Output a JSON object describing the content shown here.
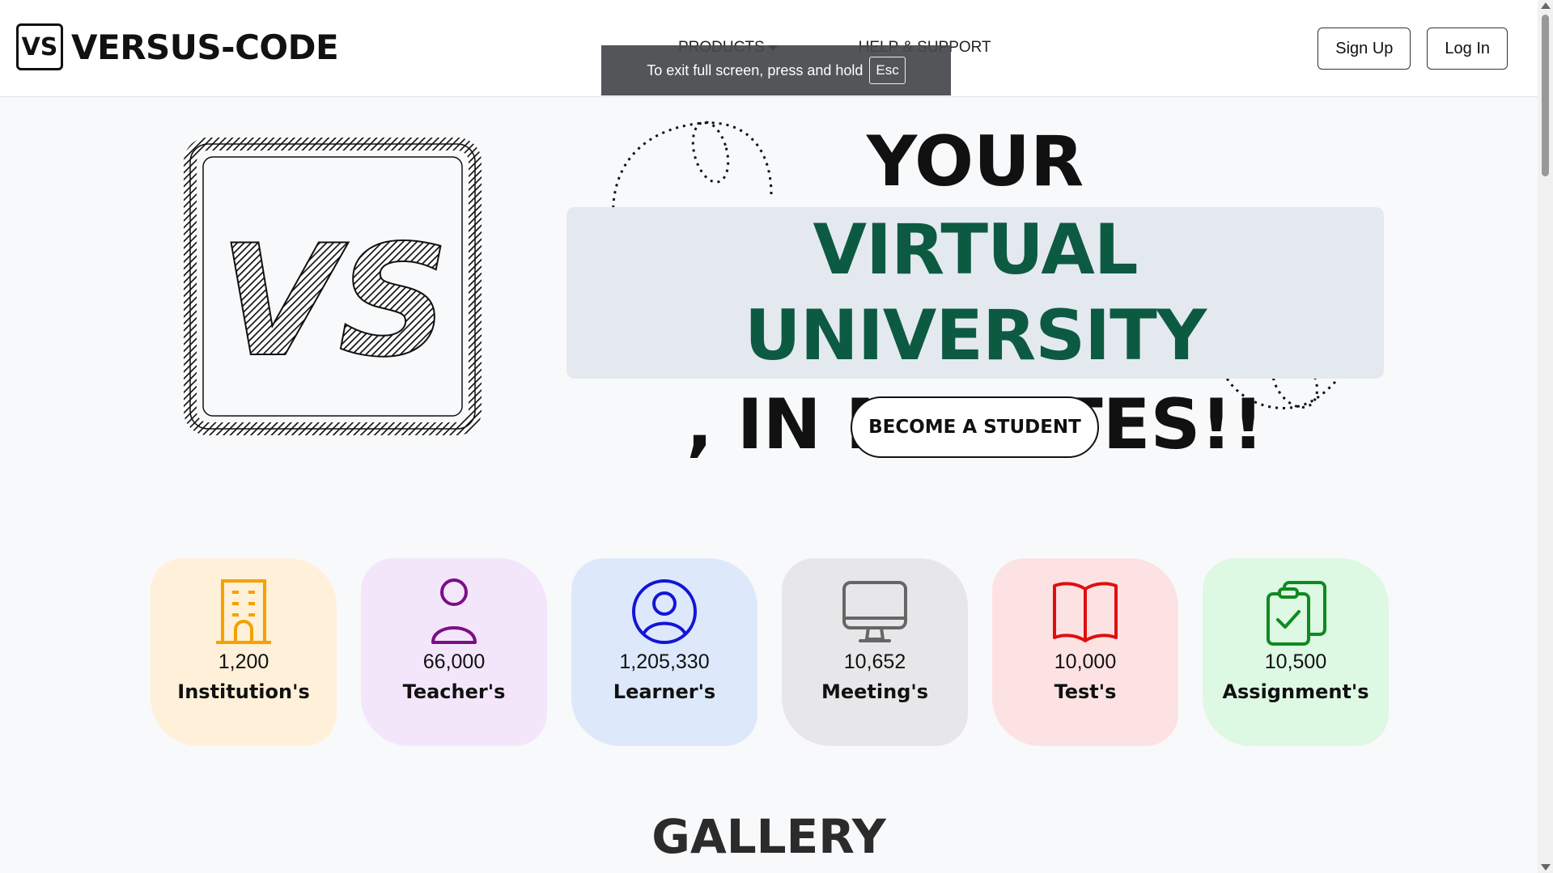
{
  "navbar": {
    "brand_logo_text": "VS",
    "brand_name": "VERSUS-CODE",
    "links": [
      {
        "label": "PRODUCTS",
        "has_dropdown": true
      },
      {
        "label": "HELP & SUPPORT",
        "has_dropdown": false
      }
    ],
    "signup_label": "Sign Up",
    "login_label": "Log In"
  },
  "fullscreen_toast": {
    "message": "To exit full screen, press and hold",
    "key": "Esc"
  },
  "hero": {
    "logo_text": "VS",
    "line1": "YOUR",
    "line2": "VIRTUAL UNIVERSITY",
    "line3": ", IN MINUTES!!",
    "cta_label": "BECOME A STUDENT",
    "highlight_color": "#0d5a42"
  },
  "stats": [
    {
      "icon": "building-icon",
      "value": "1,200",
      "label": "Institution's",
      "bg": "#fff0d9",
      "color": "#f5a100"
    },
    {
      "icon": "user-icon",
      "value": "66,000",
      "label": "Teacher's",
      "bg": "#f3e6fb",
      "color": "#7a0f87"
    },
    {
      "icon": "user-circle-icon",
      "value": "1,205,330",
      "label": "Learner's",
      "bg": "#dde9fb",
      "color": "#1414d6"
    },
    {
      "icon": "monitor-icon",
      "value": "10,652",
      "label": "Meeting's",
      "bg": "#e7e7e9",
      "color": "#666666"
    },
    {
      "icon": "book-icon",
      "value": "10,000",
      "label": "Test's",
      "bg": "#fde2e3",
      "color": "#e00f0f"
    },
    {
      "icon": "clipboard-check-icon",
      "value": "10,500",
      "label": "Assignment's",
      "bg": "#ddf8e3",
      "color": "#0f8a1f"
    }
  ],
  "gallery": {
    "title": "GALLERY"
  }
}
